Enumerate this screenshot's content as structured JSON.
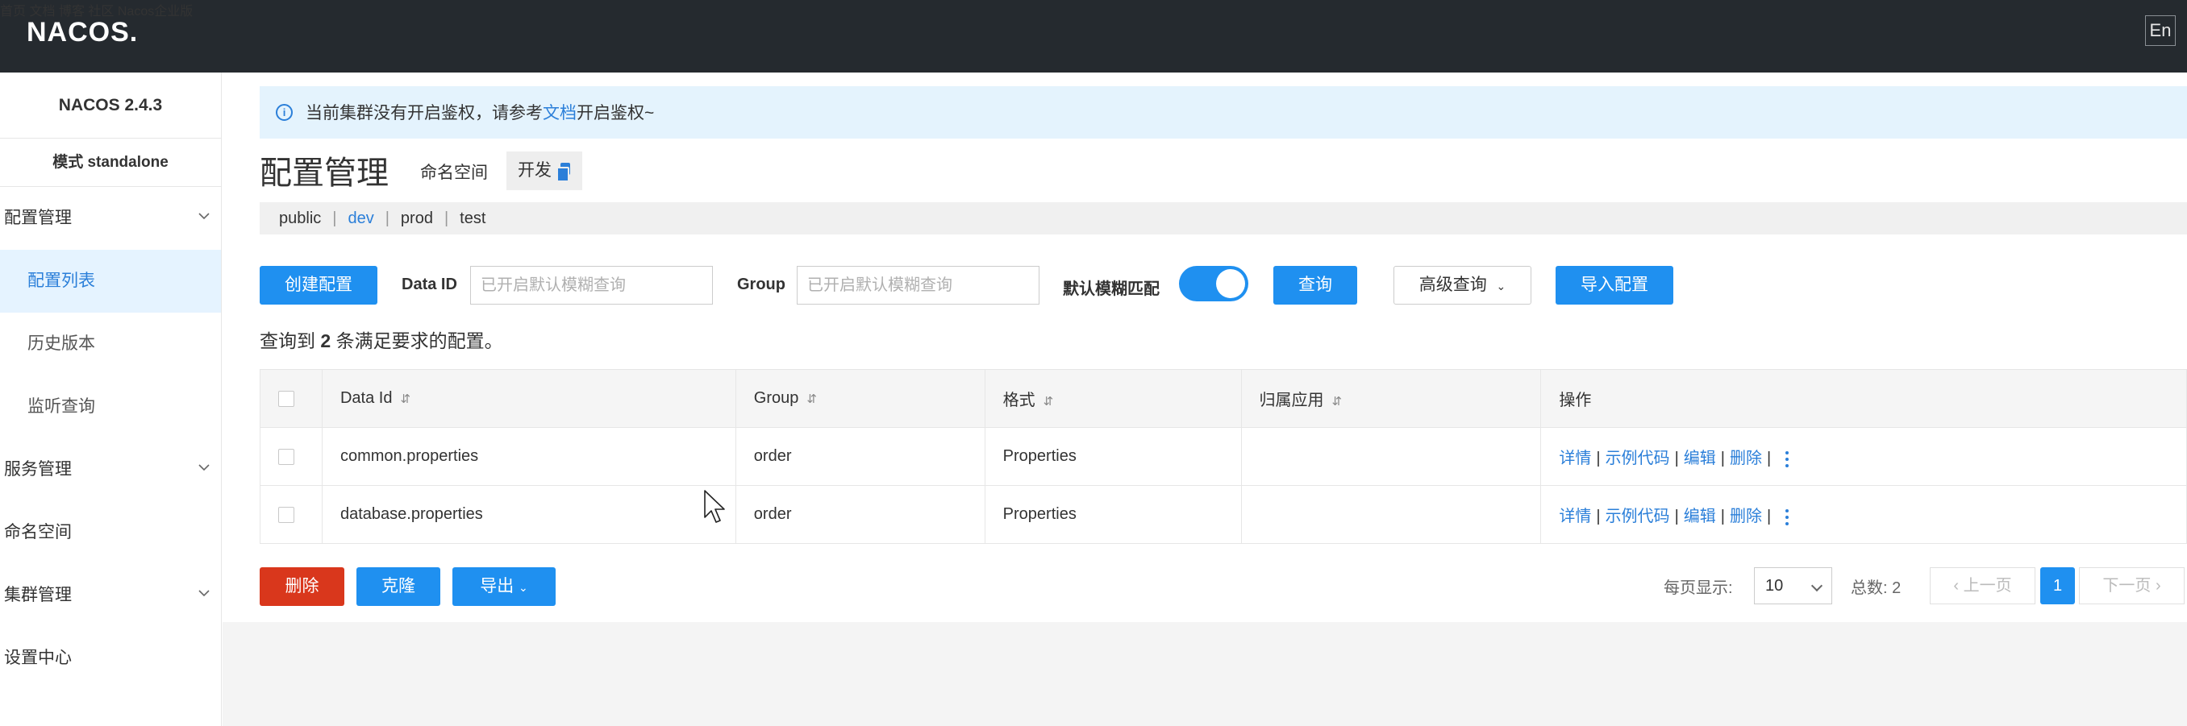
{
  "header": {
    "logo_text": "NACOS.",
    "nav": [
      "首页",
      "文档",
      "博客",
      "社区",
      "Nacos企业版"
    ],
    "lang_button": "En"
  },
  "sidebar": {
    "version": "NACOS 2.4.3",
    "mode": "模式 standalone",
    "items": [
      {
        "label": "配置管理",
        "expandable": true
      },
      {
        "label": "配置列表",
        "sub": true,
        "active": true
      },
      {
        "label": "历史版本",
        "sub": true
      },
      {
        "label": "监听查询",
        "sub": true
      },
      {
        "label": "服务管理",
        "expandable": true
      },
      {
        "label": "命名空间"
      },
      {
        "label": "集群管理",
        "expandable": true
      },
      {
        "label": "设置中心"
      }
    ]
  },
  "alert": {
    "text_before": "当前集群没有开启鉴权，请参考",
    "link": "文档",
    "text_after": "开启鉴权~"
  },
  "page": {
    "title": "配置管理",
    "namespace_label": "命名空间",
    "namespace_current": "开发"
  },
  "namespaces": [
    "public",
    "dev",
    "prod",
    "test"
  ],
  "namespace_active": "dev",
  "toolbar": {
    "create_button": "创建配置",
    "data_id_label": "Data ID",
    "data_id_placeholder": "已开启默认模糊查询",
    "group_label": "Group",
    "group_placeholder": "已开启默认模糊查询",
    "fuzzy_label": "默认模糊匹配",
    "fuzzy_enabled": true,
    "query_button": "查询",
    "advanced_query_button": "高级查询",
    "import_button": "导入配置"
  },
  "result": {
    "prefix": "查询到",
    "count": "2",
    "suffix": "条满足要求的配置。"
  },
  "table": {
    "columns": [
      "Data Id",
      "Group",
      "格式",
      "归属应用",
      "操作"
    ],
    "sort_icon": "⇵",
    "rows": [
      {
        "data_id": "common.properties",
        "group": "order",
        "format": "Properties",
        "app": ""
      },
      {
        "data_id": "database.properties",
        "group": "order",
        "format": "Properties",
        "app": ""
      }
    ],
    "actions": [
      "详情",
      "示例代码",
      "编辑",
      "删除"
    ]
  },
  "bulk": {
    "delete_button": "删除",
    "clone_button": "克隆",
    "export_button": "导出"
  },
  "pagination": {
    "per_page_label": "每页显示:",
    "per_page_value": "10",
    "total_label": "总数: 2",
    "prev": "上一页",
    "current": "1",
    "next": "下一页"
  },
  "colors": {
    "header_bg": "#252a2f",
    "primary": "#1f90f0",
    "danger": "#d9371c",
    "link": "#2b7fd9",
    "alert_bg": "#e4f3fd"
  }
}
